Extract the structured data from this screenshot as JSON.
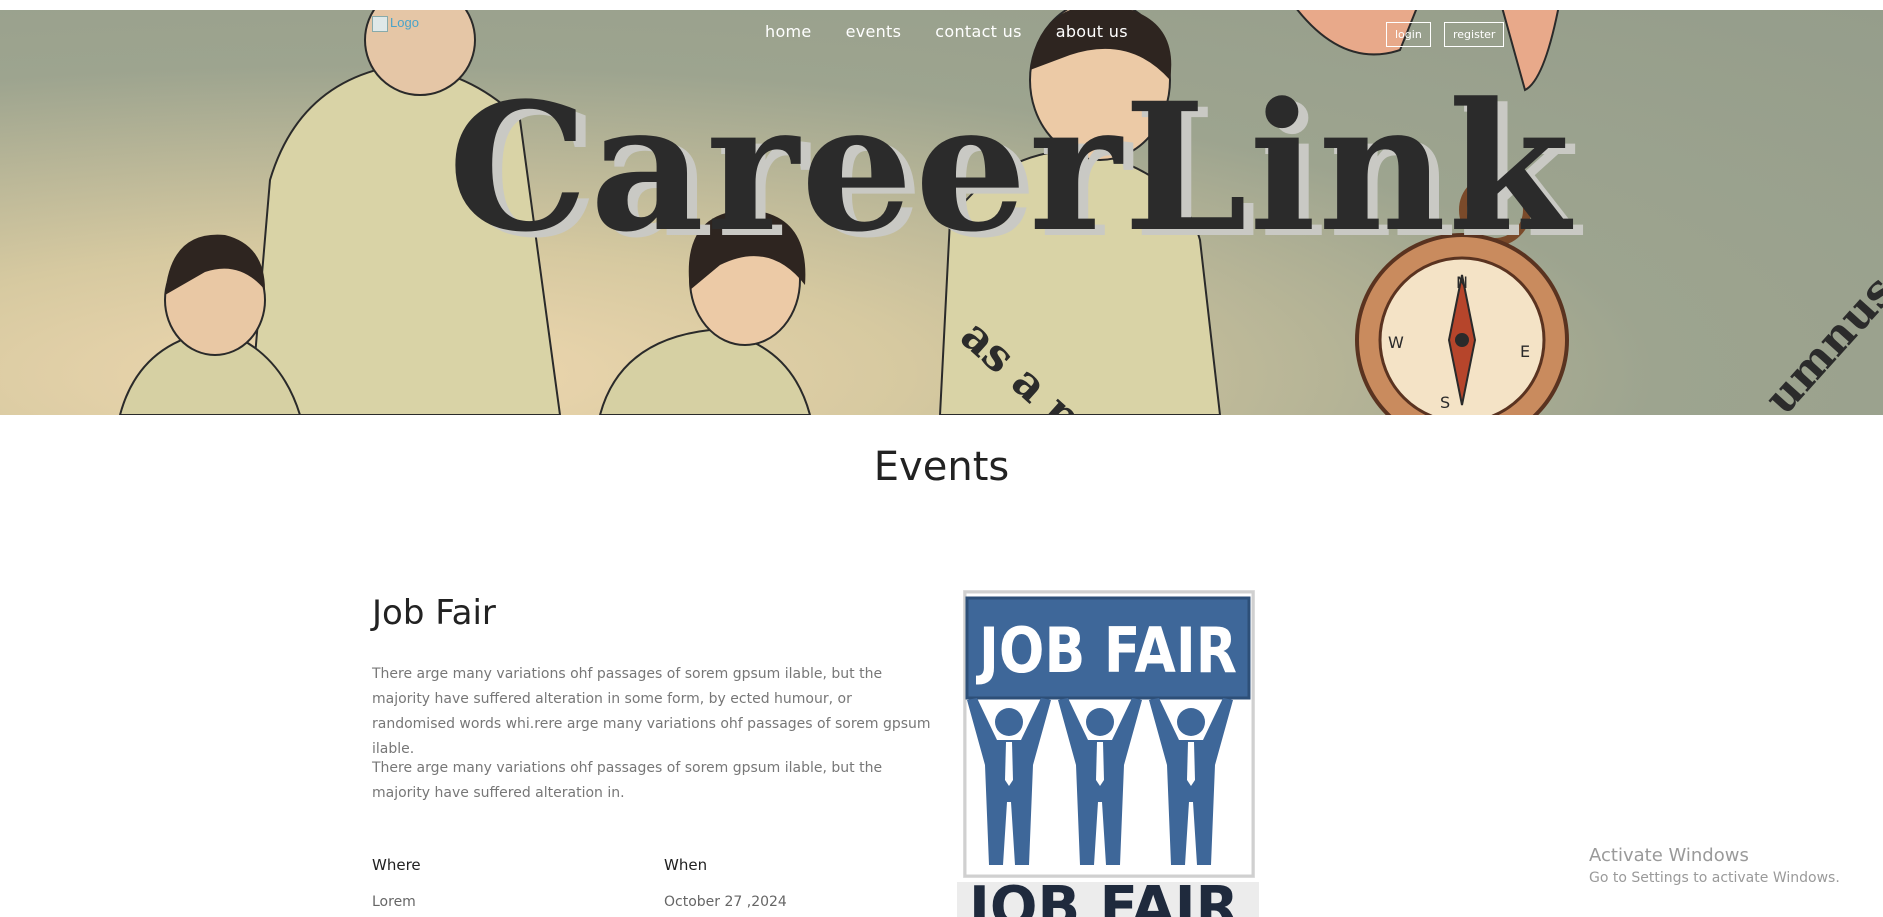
{
  "header": {
    "logo_alt": "Logo",
    "nav": [
      "home",
      "events",
      "contact us",
      "about us"
    ],
    "login_label": "login",
    "register_label": "register"
  },
  "hero": {
    "brand": "CareerLink",
    "curved_text_1": "as a pu",
    "curved_text_2": "umnus"
  },
  "events": {
    "section_title": "Events",
    "event": {
      "title": "Job Fair",
      "paragraph_1": "There arge many variations ohf passages of sorem gpsum ilable, but the majority have suffered alteration in some form, by ected humour, or randomised words whi.rere arge many variations ohf passages of sorem gpsum ilable.",
      "paragraph_2": "There arge many variations ohf passages of sorem gpsum ilable, but the majority have suffered alteration in.",
      "where_label": "Where",
      "where_value": "Lorem",
      "when_label": "When",
      "when_value": "October 27 ,2024",
      "poster_heading": "JOB FAIR",
      "poster_heading_2": "JOB FAIR"
    }
  },
  "os_overlay": {
    "title": "Activate Windows",
    "subtitle": "Go to Settings to activate Windows."
  },
  "colors": {
    "poster_blue": "#3e6799",
    "hero_bg": "#959d8b",
    "text_dark": "#222222",
    "text_muted": "#777777"
  }
}
